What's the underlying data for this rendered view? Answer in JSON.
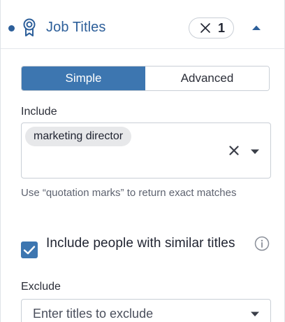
{
  "header": {
    "title": "Job Titles",
    "count": "1",
    "status_dot_color": "#2d5f9a",
    "icon": "badge-icon"
  },
  "mode_toggle": {
    "options": [
      "Simple",
      "Advanced"
    ],
    "selected": "Simple"
  },
  "include": {
    "label": "Include",
    "chips": [
      "marketing director"
    ],
    "hint": "Use “quotation marks” to return exact matches"
  },
  "similar_titles": {
    "checked": true,
    "label": "Include people with similar titles"
  },
  "exclude": {
    "label": "Exclude",
    "placeholder": "Enter titles to exclude"
  },
  "colors": {
    "accent": "#3d76b0",
    "title": "#2d5f9a",
    "border": "#c9cfd6",
    "chip_bg": "#e7e8ea"
  }
}
